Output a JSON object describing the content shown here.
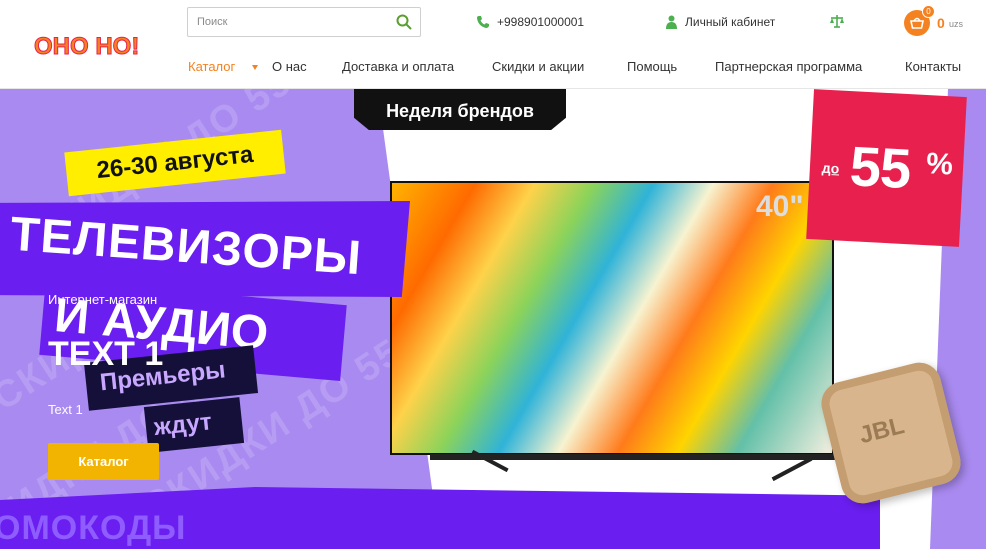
{
  "header": {
    "logo_text": "ОНО НО!",
    "search": {
      "placeholder": "Поиск"
    },
    "phone": "+998901000001",
    "account_label": "Личный кабинет",
    "cart": {
      "count": "0",
      "total": "0",
      "currency": "uzs"
    }
  },
  "nav": {
    "items": [
      "Каталог",
      "О нас",
      "Доставка и оплата",
      "Скидки и акции",
      "Помощь",
      "Партнерская программа",
      "Контакты"
    ],
    "active": "Каталог"
  },
  "banner": {
    "brand_week": "Неделя брендов",
    "dates": "26-30 августа",
    "headline_1": "ТЕЛЕВИЗОРЫ",
    "headline_2": "И АУДИО",
    "premieres_1": "Премьеры",
    "premieres_2": "ждут",
    "tv_size": "40\"",
    "discount_prefix": "до",
    "discount_value": "55",
    "discount_unit": "%",
    "watermark": "СКИДКИ ДО 55%",
    "promo_strip": "ОМОКОДЫ",
    "speaker_brand": "JBL",
    "overlay_small": "Интернет-магазин",
    "overlay_title": "TEXT 1",
    "overlay_text": "Text 1",
    "cta_label": "Каталог"
  },
  "colors": {
    "accent": "#f58220",
    "banner_bg": "#a98af0",
    "strip_purple": "#6a1ef0",
    "sale_red": "#e8204e",
    "date_yellow": "#ffee00",
    "cta_gold": "#f2b400",
    "icon_green": "#4caf50"
  }
}
